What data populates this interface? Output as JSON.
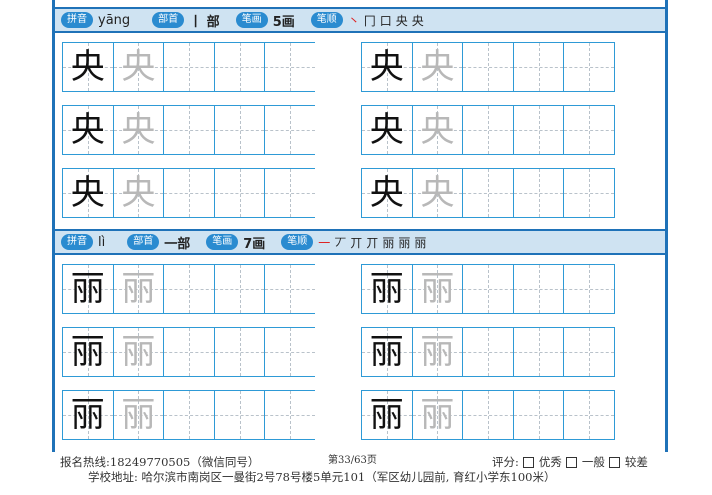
{
  "labels": {
    "pinyin": "拼音",
    "radical": "部首",
    "strokes_count": "笔画",
    "stroke_order": "笔顺"
  },
  "sections": [
    {
      "pinyin": "yāng",
      "radical": "丨 部",
      "strokes": "5画",
      "order": [
        "㇔",
        "冂",
        "口",
        "央",
        "央"
      ],
      "char": "央"
    },
    {
      "pinyin": "lì",
      "radical": "一部",
      "strokes": "7画",
      "order": [
        "一",
        "丆",
        "丌",
        "丌",
        "丽",
        "丽",
        "丽"
      ],
      "char": "丽"
    }
  ],
  "footer": {
    "hotline": "报名热线:18249770505（微信同号）",
    "page": "第33/63页",
    "score_label": "评分:",
    "score_opts": [
      "优秀",
      "一般",
      "较差"
    ],
    "address": "学校地址: 哈尔滨市南岗区一曼街2号78号楼5单元101（军区幼儿园前, 育红小学东100米）"
  }
}
